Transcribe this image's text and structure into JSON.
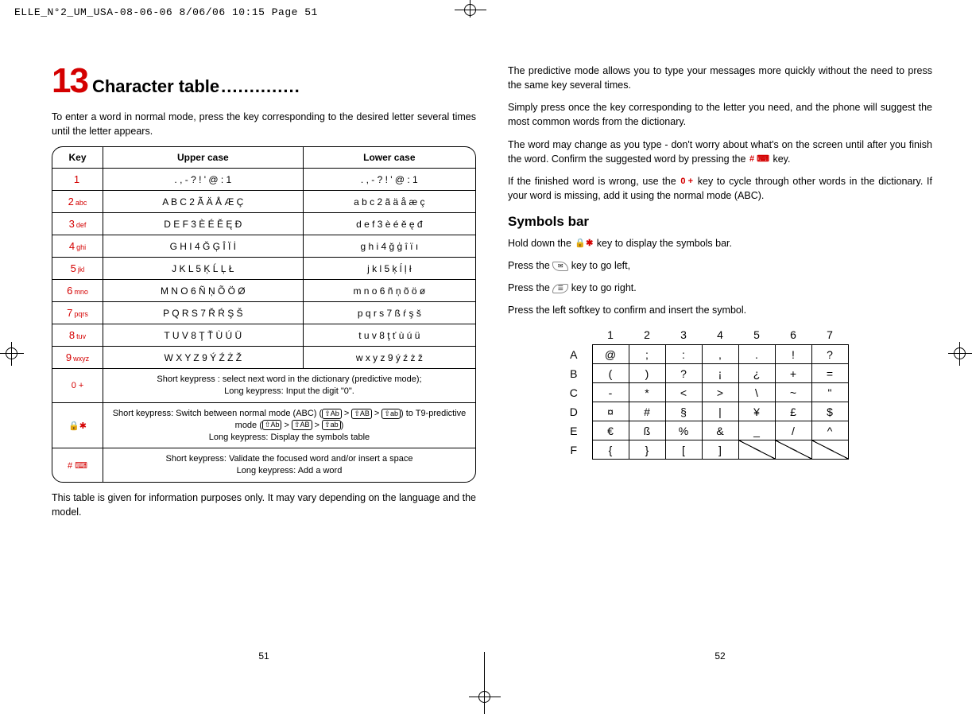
{
  "print_header": "ELLE_N°2_UM_USA-08-06-06  8/06/06  10:15  Page 51",
  "left_page": {
    "number": "51",
    "chapter_num": "13",
    "chapter_title": "Character table",
    "dots": "..............",
    "intro": "To enter a word in normal mode, press the key corresponding to the desired letter several times until the letter appears.",
    "footnote": "This table is given for information purposes only. It may vary depending on the language and the model.",
    "table": {
      "head": {
        "c1": "Key",
        "c2": "Upper case",
        "c3": "Lower case"
      },
      "rows": [
        {
          "key_digit": "1",
          "key_sub": "",
          "upper": ". , - ? ! ' @ : 1",
          "lower": ". , - ? ! ' @ : 1"
        },
        {
          "key_digit": "2",
          "key_sub": "abc",
          "upper": "A B C 2 Ã Ä Å Æ Ç",
          "lower": "a b c 2 ã ä å æ ç"
        },
        {
          "key_digit": "3",
          "key_sub": "def",
          "upper": "D E F 3 È É Ě Ę Đ",
          "lower": "d e f 3 è é ě ę đ"
        },
        {
          "key_digit": "4",
          "key_sub": "ghi",
          "upper": "G H I 4 Ğ Ģ Î Ï İ",
          "lower": "g h i 4 ğ ģ î ï ı"
        },
        {
          "key_digit": "5",
          "key_sub": "jkl",
          "upper": "J K L 5 Ķ Ĺ Ļ Ł",
          "lower": "j k l 5 ķ ĺ ļ ł"
        },
        {
          "key_digit": "6",
          "key_sub": "mno",
          "upper": "M N O 6 Ñ Ņ Õ Ö Ø",
          "lower": "m n o 6 ñ ņ õ ö ø"
        },
        {
          "key_digit": "7",
          "key_sub": "pqrs",
          "upper": "P Q R S 7 Ř Ŕ Ş Š",
          "lower": "p q r s 7 ß ŕ ş š"
        },
        {
          "key_digit": "8",
          "key_sub": "tuv",
          "upper": "T U V 8 Ţ Ť Ù Ú Ü",
          "lower": "t u v 8 ţ ť ù ú ü"
        },
        {
          "key_digit": "9",
          "key_sub": "wxyz",
          "upper": "W X Y Z 9 Ý Ź Ż Ž",
          "lower": "w x y z 9 ý ź ż ž"
        }
      ],
      "row0": {
        "key_icon": "0 +",
        "text": "Short keypress : select next word in the dictionary (predictive mode);<br>Long keypress: Input the digit \"0\"."
      },
      "rowStar": {
        "key_icon": "🔒✱",
        "text_a": "Short keypress: Switch between normal mode (ABC) (",
        "seq1a": "⇧Ab",
        "seq1b": "⇧AB",
        "seq1c": "⇧ab",
        "text_b": ") to T9-predictive mode (",
        "seq2a": "⇧Ab",
        "seq2b": "⇧AB",
        "seq2c": "⇧ab",
        "text_c": ")",
        "text_d": "Long keypress: Display the symbols table"
      },
      "rowHash": {
        "key_icon": "# ⌨",
        "text": "Short keypress: Validate the focused word and/or insert a space<br>Long keypress: Add a word"
      }
    }
  },
  "right_page": {
    "number": "52",
    "p1": "The predictive mode allows you to type your messages more quickly without the need to press the same key several times.",
    "p2": "Simply press once the key corresponding to the letter you need, and the phone will suggest the most common words from the dictionary.",
    "p3a": "The word may change as you type - don't worry about what's on the screen until after you finish the word. Confirm the suggested word by pressing the ",
    "p3_key": "# ⌨",
    "p3b": " key.",
    "p4a": "If the finished word is wrong, use the ",
    "p4_key": "0 +",
    "p4b": " key to cycle through other words in the dictionary. If your word is missing, add it using the normal mode (ABC).",
    "sub": "Symbols bar",
    "s1a": "Hold down the ",
    "s1_key": "🔒✱",
    "s1b": " key to display the symbols bar.",
    "s2a": "Press the ",
    "s2_icon": "✉",
    "s2b": " key to go left,",
    "s3a": "Press the ",
    "s3_icon": "☰",
    "s3b": " key to go right.",
    "s4": "Press the left softkey to confirm and insert the symbol.",
    "sym_cols": [
      "1",
      "2",
      "3",
      "4",
      "5",
      "6",
      "7"
    ],
    "sym_rows": [
      {
        "h": "A",
        "c": [
          "@",
          ";",
          ":",
          ",",
          ".",
          "!",
          "?"
        ]
      },
      {
        "h": "B",
        "c": [
          "(",
          ")",
          "?",
          "¡",
          "¿",
          "+",
          "="
        ]
      },
      {
        "h": "C",
        "c": [
          "-",
          "*",
          "<",
          ">",
          "\\",
          "~",
          "\""
        ]
      },
      {
        "h": "D",
        "c": [
          "¤",
          "#",
          "§",
          "|",
          "¥",
          "£",
          "$"
        ]
      },
      {
        "h": "E",
        "c": [
          "€",
          "ß",
          "%",
          "&",
          "_",
          "/",
          "^"
        ]
      },
      {
        "h": "F",
        "c": [
          "{",
          "}",
          "[",
          "]",
          null,
          null,
          null
        ]
      }
    ]
  }
}
